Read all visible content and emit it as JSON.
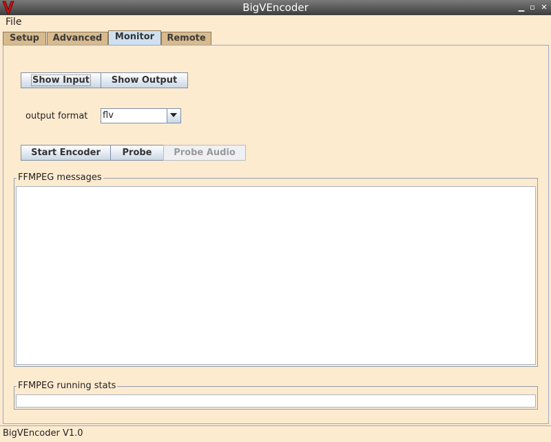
{
  "window": {
    "title": "BigVEncoder"
  },
  "menu": {
    "file": "File"
  },
  "tabs": [
    {
      "label": "Setup"
    },
    {
      "label": "Advanced"
    },
    {
      "label": "Monitor"
    },
    {
      "label": "Remote"
    }
  ],
  "monitor": {
    "show_input": "Show Input",
    "show_output": "Show Output",
    "output_format_label": "output format",
    "output_format_value": "flv",
    "start_encoder": "Start Encoder",
    "probe": "Probe",
    "probe_audio": "Probe Audio",
    "messages_title": "FFMPEG messages",
    "stats_title": "FFMPEG running stats"
  },
  "status": {
    "text": "BigVEncoder V1.0"
  },
  "colors": {
    "background": "#fdebd0",
    "tab_inactive": "#d8ba8c",
    "tab_active": "#cfe0f0",
    "app_icon": "#cc1111"
  }
}
